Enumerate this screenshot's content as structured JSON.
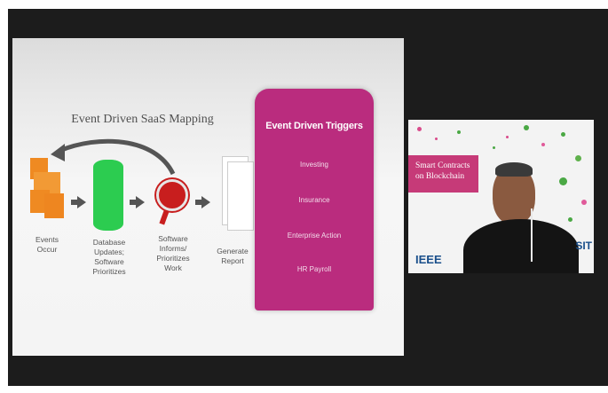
{
  "slide": {
    "title": "Event Driven SaaS Mapping",
    "steps": [
      {
        "label": "Events\nOccur"
      },
      {
        "label": "Database\nUpdates;\nSoftware\nPrioritizes"
      },
      {
        "label": "Software\nInforms/\nPrioritizes\nWork"
      },
      {
        "label": "Generate\nReport"
      }
    ],
    "panel": {
      "header": "Event Driven Triggers",
      "items": [
        "Investing",
        "Insurance",
        "Enterprise Action",
        "HR Payroll"
      ]
    }
  },
  "video": {
    "title": "Smart Contracts on Blockchain",
    "brand_left": "IEEE",
    "brand_right": "SIT"
  },
  "colors": {
    "panel": "#ba2c7e",
    "events": "#ef8a22",
    "database": "#2ccc50",
    "software": "#c81e1e"
  }
}
